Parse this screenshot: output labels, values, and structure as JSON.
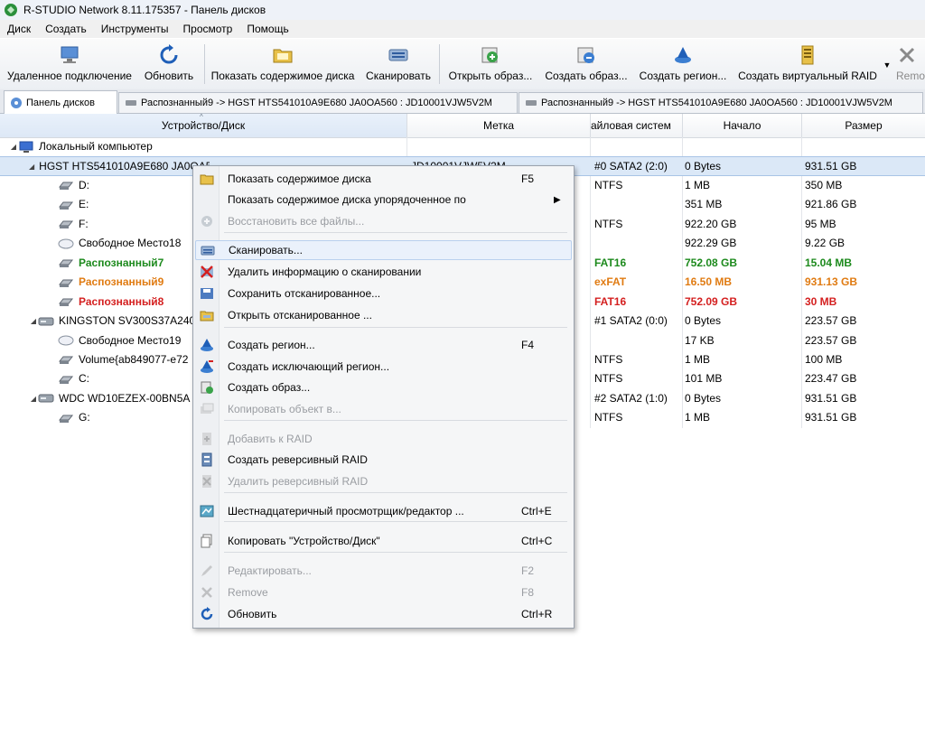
{
  "window": {
    "title": "R-STUDIO Network 8.11.175357 - Панель дисков"
  },
  "menu": [
    "Диск",
    "Создать",
    "Инструменты",
    "Просмотр",
    "Помощь"
  ],
  "toolbar": [
    {
      "label": "Удаленное подключение",
      "icon": "remote-computer-icon"
    },
    {
      "label": "Обновить",
      "icon": "refresh-icon"
    },
    {
      "label": "Показать содержимое диска",
      "icon": "folder-open-icon"
    },
    {
      "label": "Сканировать",
      "icon": "scan-icon"
    },
    {
      "label": "Открыть образ...",
      "icon": "open-image-icon"
    },
    {
      "label": "Создать образ...",
      "icon": "create-image-icon"
    },
    {
      "label": "Создать регион...",
      "icon": "create-region-icon"
    },
    {
      "label": "Создать виртуальный RAID",
      "icon": "virtual-raid-icon"
    },
    {
      "label": "Remo",
      "icon": "remove-icon"
    }
  ],
  "tabs": [
    {
      "label": "Панель дисков",
      "active": true
    },
    {
      "label": "Распознанный9 -> HGST HTS541010A9E680 JA0OA560 : JD10001VJW5V2M",
      "active": false
    },
    {
      "label": "Распознанный9 -> HGST HTS541010A9E680 JA0OA560 : JD10001VJW5V2M",
      "active": false
    }
  ],
  "columns": [
    "Устройство/Диск",
    "Метка",
    "Файловая система",
    "Начало",
    "Размер"
  ],
  "columns_visible": {
    "fs": "айловая систем"
  },
  "rows": [
    {
      "name": "Локальный компьютер",
      "level": 0,
      "toggle": "◢",
      "icon": "computer-icon",
      "label": "",
      "fs": "",
      "start": "",
      "size": "",
      "color": ""
    },
    {
      "name": "HGST HTS541010A9E680 JA0OA560",
      "level": 1,
      "toggle": "◢",
      "icon": "hdd-icon",
      "label": "JD10001VJW5V2M",
      "fs": "#0 SATA2 (2:0)",
      "start": "0 Bytes",
      "size": "931.51 GB",
      "color": "",
      "selected": true
    },
    {
      "name": "D:",
      "level": 2,
      "icon": "partition-icon",
      "label": "",
      "fs": "NTFS",
      "start": "1 MB",
      "size": "350 MB",
      "color": ""
    },
    {
      "name": "E:",
      "level": 2,
      "icon": "partition-icon",
      "label": "",
      "fs": "",
      "start": "351 MB",
      "size": "921.86 GB",
      "color": ""
    },
    {
      "name": "F:",
      "level": 2,
      "icon": "partition-icon",
      "label": "",
      "fs": "NTFS",
      "start": "922.20 GB",
      "size": "95 MB",
      "color": ""
    },
    {
      "name": "Свободное Место18",
      "level": 2,
      "icon": "free-space-icon",
      "label": "",
      "fs": "",
      "start": "922.29 GB",
      "size": "9.22 GB",
      "color": ""
    },
    {
      "name": "Распознанный7",
      "level": 2,
      "icon": "partition-icon",
      "label": "",
      "fs": "FAT16",
      "start": "752.08 GB",
      "size": "15.04 MB",
      "color": "green"
    },
    {
      "name": "Распознанный9",
      "level": 2,
      "icon": "partition-icon",
      "label": "",
      "fs": "exFAT",
      "start": "16.50 MB",
      "size": "931.13 GB",
      "color": "orange"
    },
    {
      "name": "Распознанный8",
      "level": 2,
      "icon": "partition-icon",
      "label": "",
      "fs": "FAT16",
      "start": "752.09 GB",
      "size": "30 MB",
      "color": "red"
    },
    {
      "name": "KINGSTON SV300S37A240",
      "level": 1,
      "toggle": "◢",
      "icon": "hdd-icon",
      "label": "",
      "fs": "#1 SATA2 (0:0)",
      "start": "0 Bytes",
      "size": "223.57 GB",
      "color": ""
    },
    {
      "name": "Свободное Место19",
      "level": 2,
      "icon": "free-space-icon",
      "label": "",
      "fs": "",
      "start": "17 KB",
      "size": "223.57 GB",
      "color": ""
    },
    {
      "name": "Volume{ab849077-e72",
      "level": 2,
      "icon": "partition-icon",
      "label": "",
      "fs": "NTFS",
      "start": "1 MB",
      "size": "100 MB",
      "color": ""
    },
    {
      "name": "C:",
      "level": 2,
      "icon": "partition-icon",
      "label": "",
      "fs": "NTFS",
      "start": "101 MB",
      "size": "223.47 GB",
      "color": ""
    },
    {
      "name": "WDC WD10EZEX-00BN5A",
      "level": 1,
      "toggle": "◢",
      "icon": "hdd-icon",
      "label": "",
      "fs": "#2 SATA2 (1:0)",
      "start": "0 Bytes",
      "size": "931.51 GB",
      "color": ""
    },
    {
      "name": "G:",
      "level": 2,
      "icon": "partition-icon",
      "label": "",
      "fs": "NTFS",
      "start": "1 MB",
      "size": "931.51 GB",
      "color": ""
    }
  ],
  "context_menu": [
    {
      "label": "Показать содержимое диска",
      "key": "F5",
      "icon": "open-folder-icon",
      "disabled": false
    },
    {
      "label": "Показать содержимое диска упорядоченное по",
      "key": "",
      "submenu": true,
      "icon": "",
      "disabled": false
    },
    {
      "label": "Восстановить все файлы...",
      "key": "",
      "icon": "recover-icon",
      "disabled": true
    },
    {
      "sep": true
    },
    {
      "label": "Сканировать...",
      "key": "",
      "icon": "scan-icon",
      "disabled": false,
      "hover": true
    },
    {
      "label": "Удалить информацию о сканировании",
      "key": "",
      "icon": "delete-scan-icon",
      "disabled": false
    },
    {
      "label": "Сохранить отсканированное...",
      "key": "",
      "icon": "save-scan-icon",
      "disabled": false
    },
    {
      "label": "Открыть отсканированное ...",
      "key": "",
      "icon": "open-scan-icon",
      "disabled": false
    },
    {
      "sep": true
    },
    {
      "label": "Создать регион...",
      "key": "F4",
      "icon": "region-icon",
      "disabled": false
    },
    {
      "label": "Создать исключающий регион...",
      "key": "",
      "icon": "exclude-region-icon",
      "disabled": false
    },
    {
      "label": "Создать образ...",
      "key": "",
      "icon": "image-icon",
      "disabled": false
    },
    {
      "label": "Копировать объект в...",
      "key": "",
      "icon": "copy-object-icon",
      "disabled": true
    },
    {
      "sep": true
    },
    {
      "label": "Добавить к RAID",
      "key": "",
      "icon": "add-raid-icon",
      "disabled": true
    },
    {
      "label": "Создать реверсивный RAID",
      "key": "",
      "icon": "reverse-raid-icon",
      "disabled": false
    },
    {
      "label": "Удалить реверсивный RAID",
      "key": "",
      "icon": "delete-raid-icon",
      "disabled": true
    },
    {
      "sep": true
    },
    {
      "label": "Шестнадцатеричный просмотрщик/редактор ...",
      "key": "Ctrl+E",
      "icon": "hex-editor-icon",
      "disabled": false
    },
    {
      "sep": true
    },
    {
      "label": "Копировать \"Устройство/Диск\"",
      "key": "Ctrl+C",
      "icon": "copy-icon",
      "disabled": false
    },
    {
      "sep": true
    },
    {
      "label": "Редактировать...",
      "key": "F2",
      "icon": "edit-icon",
      "disabled": true
    },
    {
      "label": "Remove",
      "key": "F8",
      "icon": "remove-icon",
      "disabled": true
    },
    {
      "label": "Обновить",
      "key": "Ctrl+R",
      "icon": "refresh-icon",
      "disabled": false
    }
  ],
  "colors": {
    "green": "#1d8a1d",
    "orange": "#e07b12",
    "red": "#d42020",
    "selection": "#dbe8f7"
  }
}
